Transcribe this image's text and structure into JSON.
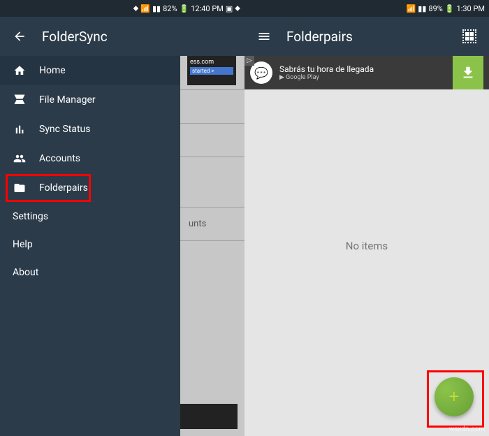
{
  "left": {
    "status": {
      "battery": "82%",
      "time": "12:40 PM"
    },
    "appbar": {
      "title": "FolderSync"
    },
    "drawer": {
      "items": [
        {
          "icon": "home",
          "label": "Home",
          "active": true
        },
        {
          "icon": "drive",
          "label": "File Manager"
        },
        {
          "icon": "chart",
          "label": "Sync Status"
        },
        {
          "icon": "users",
          "label": "Accounts"
        },
        {
          "icon": "folder",
          "label": "Folderpairs"
        }
      ],
      "sections": [
        {
          "label": "Settings"
        },
        {
          "label": "Help"
        },
        {
          "label": "About"
        }
      ]
    },
    "bg": {
      "ad_text": "ess.com",
      "ad_started": "started >",
      "row_label": "unts"
    }
  },
  "right": {
    "status": {
      "battery": "89%",
      "time": "1:30 PM"
    },
    "appbar": {
      "title": "Folderpairs"
    },
    "ad": {
      "text": "Sabrás tu hora de llegada",
      "sub": "Google Play"
    },
    "empty": "No items"
  },
  "watermark": "wsxdn.com"
}
